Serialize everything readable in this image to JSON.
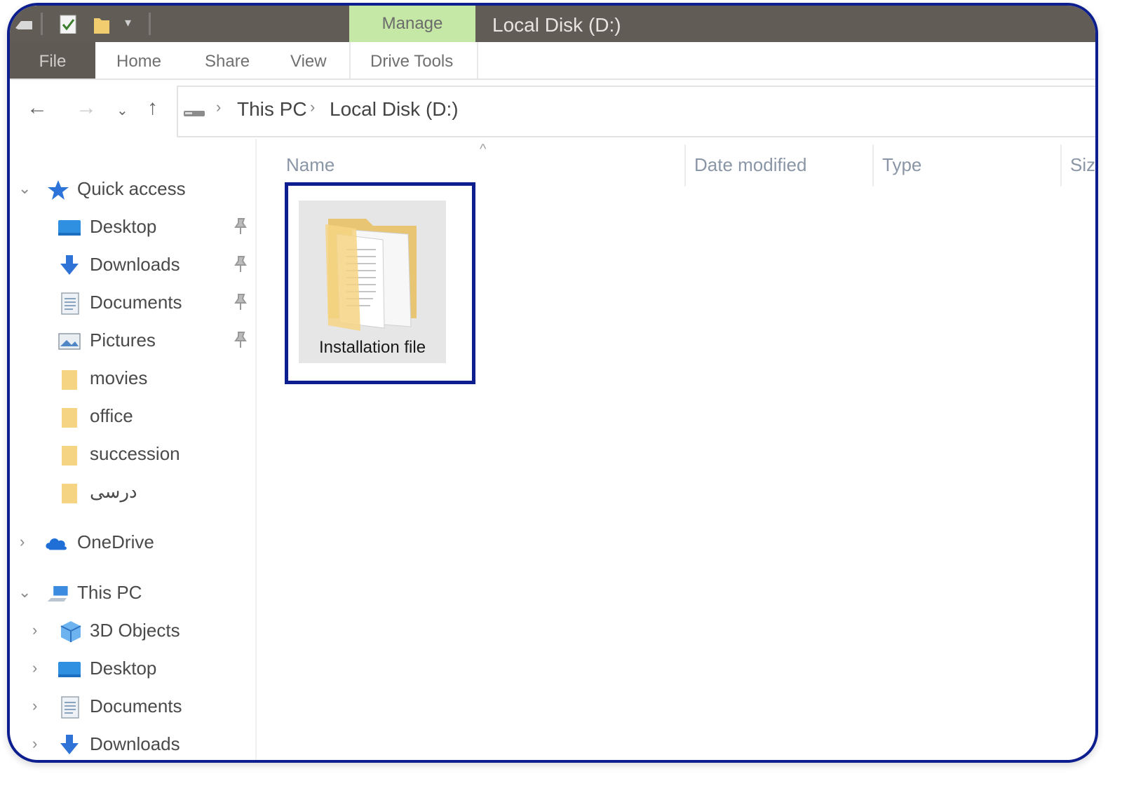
{
  "title_bar": {
    "manage_tab": "Manage",
    "window_title": "Local Disk (D:)",
    "quick_access_toolbar": [
      "properties-icon",
      "new-folder-icon",
      "customize-dropdown-icon"
    ]
  },
  "ribbon": {
    "tabs": [
      {
        "label": "File",
        "active": false
      },
      {
        "label": "Home"
      },
      {
        "label": "Share"
      },
      {
        "label": "View"
      },
      {
        "label": "Drive Tools"
      }
    ]
  },
  "address_bar": {
    "breadcrumb": [
      "This PC",
      "Local Disk (D:)"
    ]
  },
  "nav_pane": {
    "quick_access": {
      "label": "Quick access",
      "items": [
        {
          "label": "Desktop",
          "icon": "desktop-icon",
          "pinned": true
        },
        {
          "label": "Downloads",
          "icon": "downloads-icon",
          "pinned": true
        },
        {
          "label": "Documents",
          "icon": "documents-icon",
          "pinned": true
        },
        {
          "label": "Pictures",
          "icon": "pictures-icon",
          "pinned": true
        },
        {
          "label": "movies",
          "icon": "folder-icon",
          "pinned": false
        },
        {
          "label": "office",
          "icon": "folder-icon",
          "pinned": false
        },
        {
          "label": "succession",
          "icon": "folder-icon",
          "pinned": false
        },
        {
          "label": "درسی",
          "icon": "folder-icon",
          "pinned": false
        }
      ]
    },
    "onedrive": {
      "label": "OneDrive"
    },
    "this_pc": {
      "label": "This PC",
      "items": [
        {
          "label": "3D Objects",
          "icon": "3d-objects-icon"
        },
        {
          "label": "Desktop",
          "icon": "desktop-icon"
        },
        {
          "label": "Documents",
          "icon": "documents-icon"
        },
        {
          "label": "Downloads",
          "icon": "downloads-icon"
        }
      ]
    }
  },
  "content": {
    "columns": [
      "Name",
      "Date modified",
      "Type",
      "Siz"
    ],
    "items": [
      {
        "label": "Installation file",
        "icon": "folder-with-documents-icon",
        "highlighted": true
      }
    ]
  },
  "colors": {
    "title_bar": "#615c55",
    "manage_tab": "#c5e8a6",
    "highlight_border": "#0d1f8f",
    "folder_yellow": "#f5d483"
  }
}
